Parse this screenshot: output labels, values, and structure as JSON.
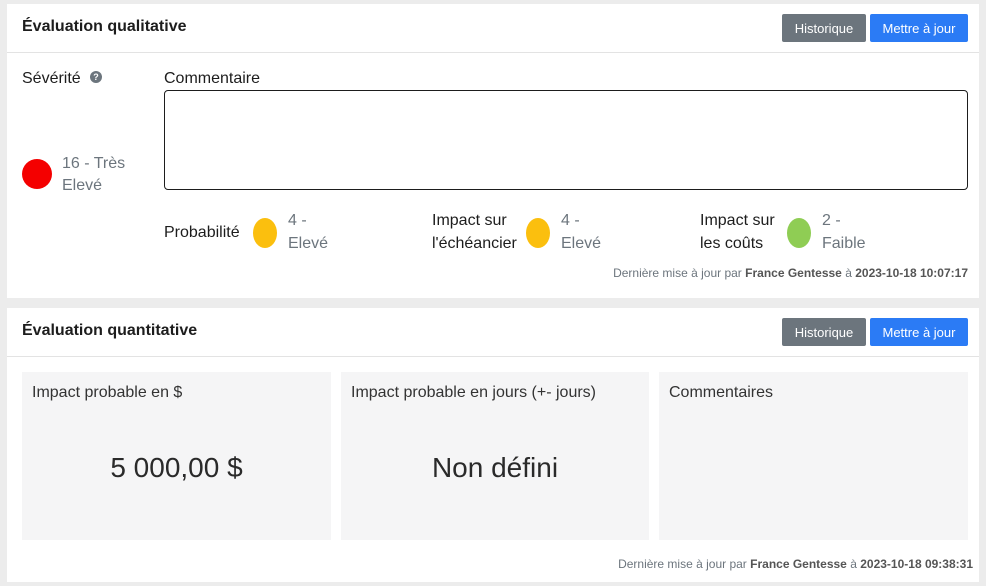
{
  "qualitative": {
    "title": "Évaluation qualitative",
    "history_label": "Historique",
    "update_label": "Mettre à jour",
    "severity_label": "Sévérité",
    "help_glyph": "?",
    "severity_value_line1": "16 - Très",
    "severity_value_line2": "Elevé",
    "severity_color": "#f40000",
    "comment_label": "Commentaire",
    "comment_value": "",
    "probability_label": "Probabilité",
    "probability_value_line1": "4 -",
    "probability_value_line2": "Elevé",
    "probability_color": "#fbbf0e",
    "schedule_label_line1": "Impact sur",
    "schedule_label_line2": "l'échéancier",
    "schedule_value_line1": "4 -",
    "schedule_value_line2": "Elevé",
    "schedule_color": "#fbbf0e",
    "cost_label_line1": "Impact sur",
    "cost_label_line2": "les coûts",
    "cost_value_line1": "2 -",
    "cost_value_line2": "Faible",
    "cost_color": "#8fcd54",
    "footer_prefix": "Dernière mise à jour par",
    "footer_user": "France Gentesse",
    "footer_at": "à",
    "footer_date": "2023-10-18 10:07:17"
  },
  "quantitative": {
    "title": "Évaluation quantitative",
    "history_label": "Historique",
    "update_label": "Mettre à jour",
    "cards": [
      {
        "title": "Impact probable en $",
        "value": "5 000,00 $"
      },
      {
        "title": "Impact probable en jours (+- jours)",
        "value": "Non défini"
      },
      {
        "title": "Commentaires",
        "value": ""
      }
    ],
    "footer_prefix": "Dernière mise à jour par",
    "footer_user": "France Gentesse",
    "footer_at": "à",
    "footer_date": "2023-10-18 09:38:31"
  },
  "colors": {
    "primary": "#2b7bf5",
    "secondary": "#6c757d"
  },
  "icons": {
    "help": "question-circle-icon"
  }
}
